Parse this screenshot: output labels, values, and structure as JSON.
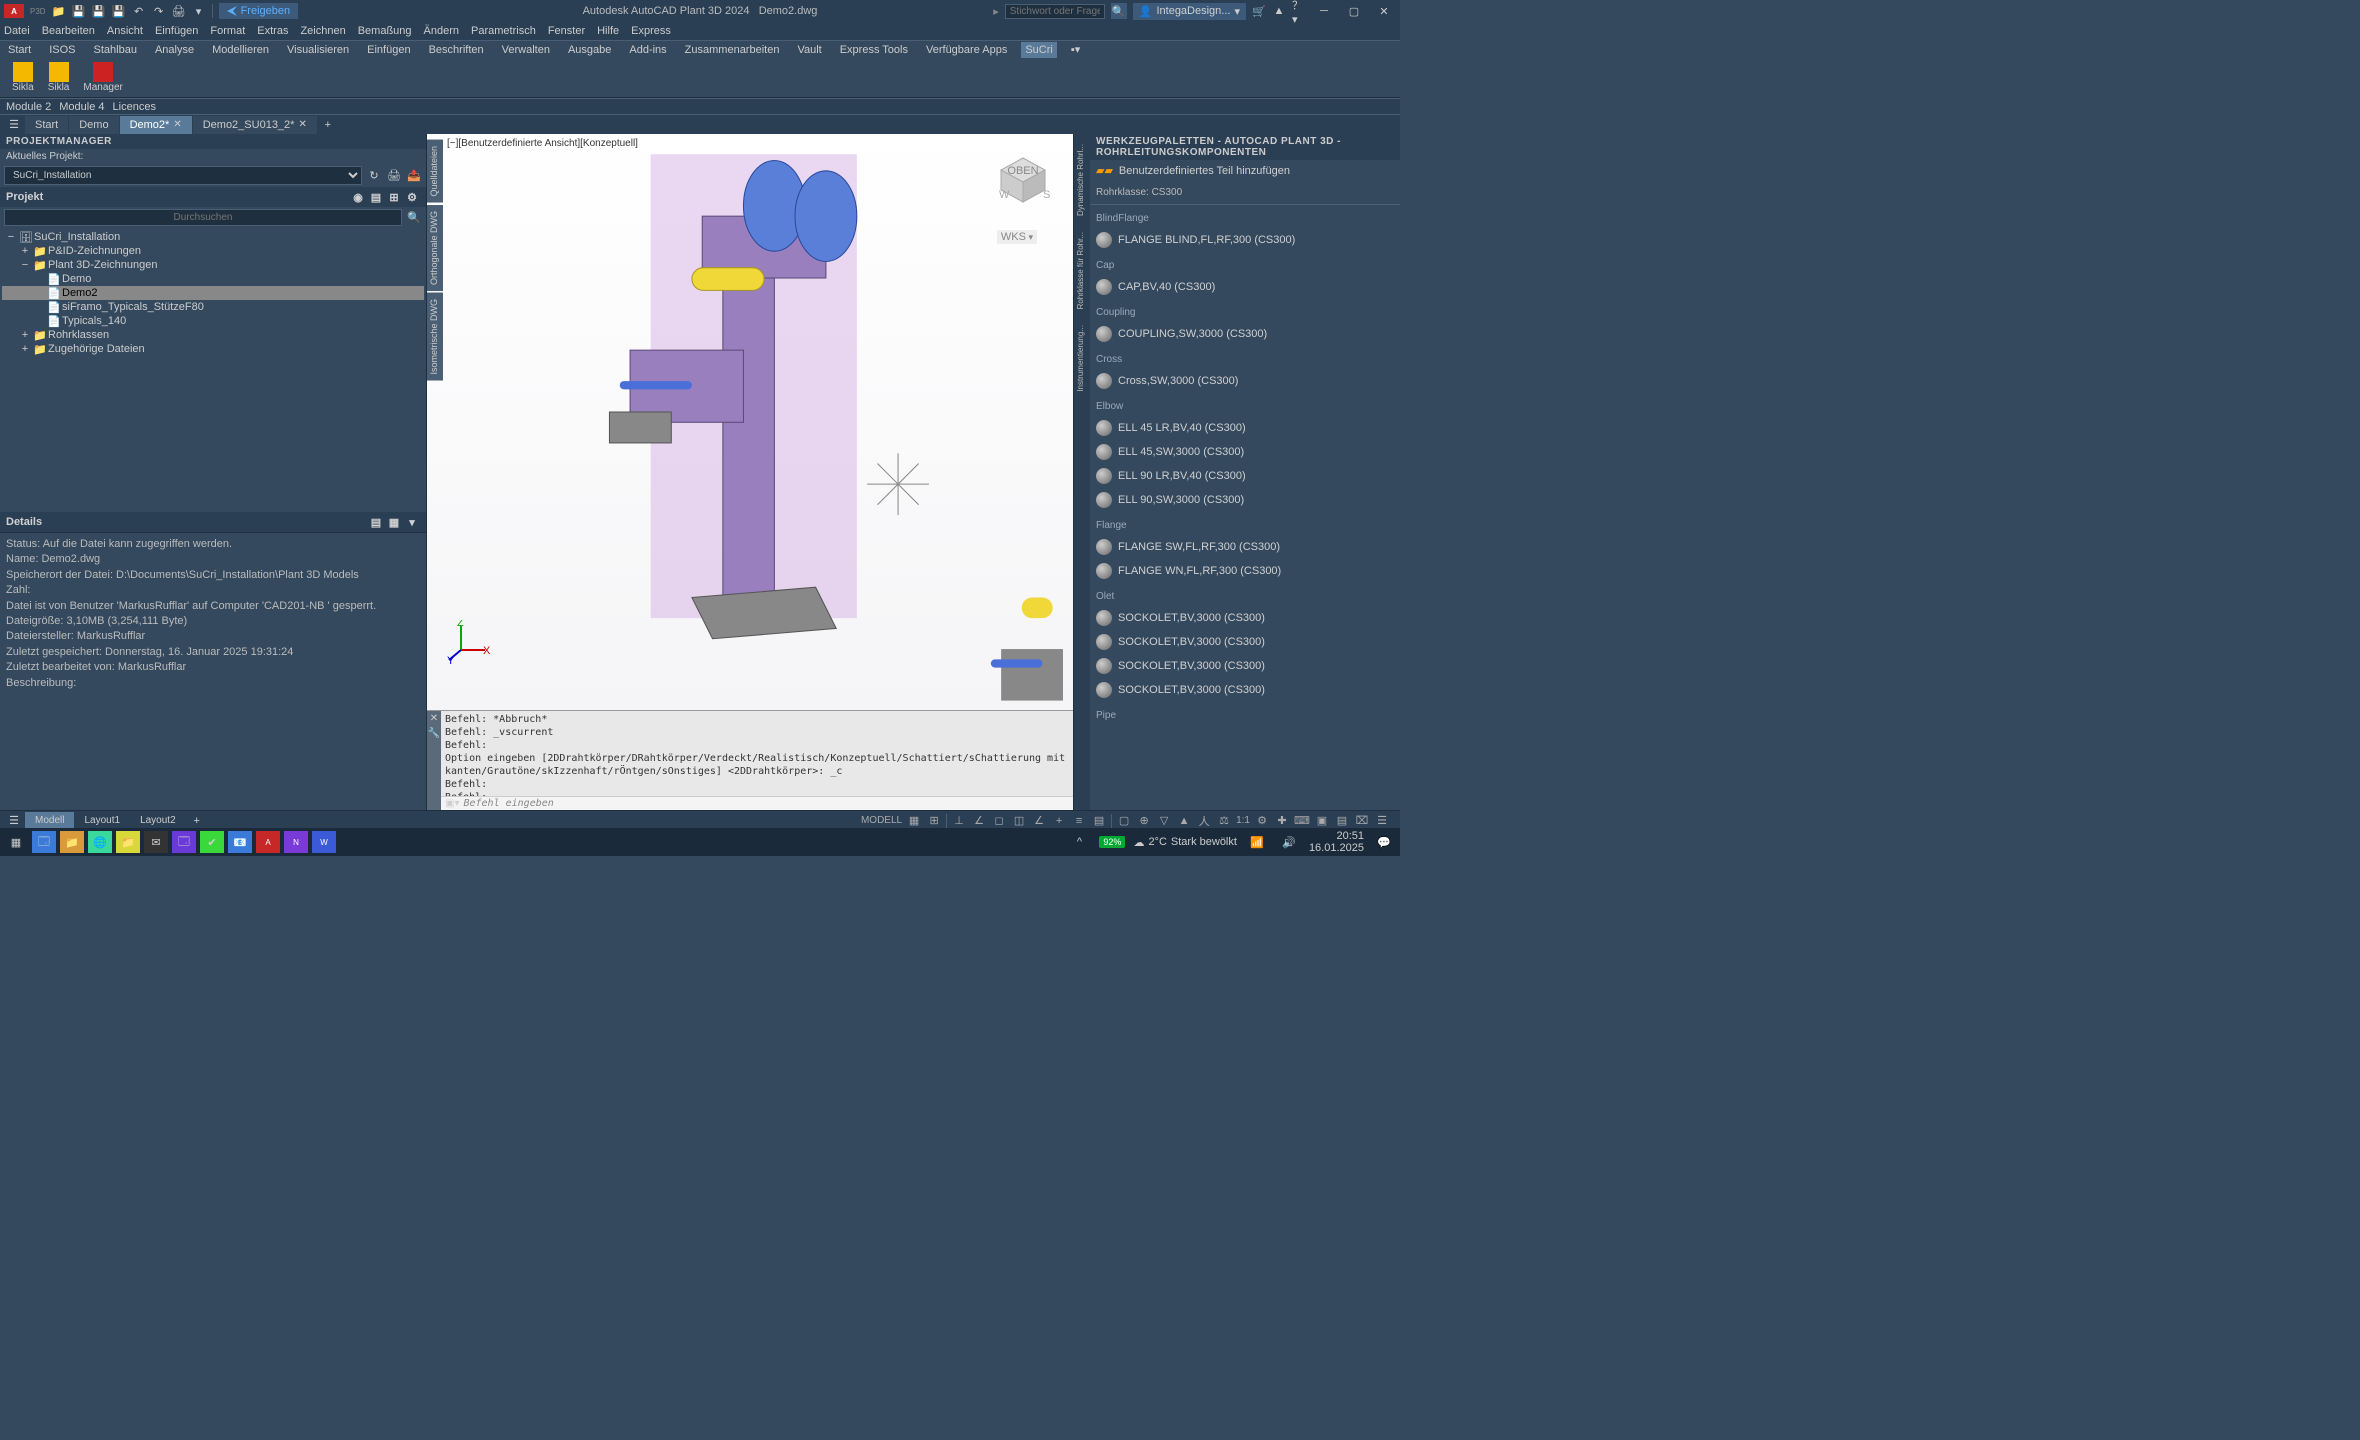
{
  "title": {
    "app": "Autodesk AutoCAD Plant 3D 2024",
    "file": "Demo2.dwg"
  },
  "share_label": "Freigeben",
  "search_placeholder": "Stichwort oder Frage eingeben",
  "user": "IntegaDesign...",
  "menubar": [
    "Datei",
    "Bearbeiten",
    "Ansicht",
    "Einfügen",
    "Format",
    "Extras",
    "Zeichnen",
    "Bemaßung",
    "Ändern",
    "Parametrisch",
    "Fenster",
    "Hilfe",
    "Express"
  ],
  "ribbon_tabs": [
    "Start",
    "ISOS",
    "Stahlbau",
    "Analyse",
    "Modellieren",
    "Visualisieren",
    "Einfügen",
    "Beschriften",
    "Verwalten",
    "Ausgabe",
    "Add-ins",
    "Zusammenarbeiten",
    "Vault",
    "Express Tools",
    "Verfügbare Apps",
    "SuCri"
  ],
  "ribbon_buttons": [
    {
      "label": "Sikla"
    },
    {
      "label": "Sikla"
    },
    {
      "label": "Manager"
    }
  ],
  "panel_labels": [
    "Module 2",
    "Module 4",
    "Licences"
  ],
  "doc_tabs": [
    {
      "label": "Start",
      "closable": false,
      "active": false
    },
    {
      "label": "Demo",
      "closable": false,
      "active": false
    },
    {
      "label": "Demo2*",
      "closable": true,
      "active": true
    },
    {
      "label": "Demo2_SU013_2*",
      "closable": true,
      "active": false
    }
  ],
  "pm": {
    "title": "PROJEKTMANAGER",
    "current_label": "Aktuelles Projekt:",
    "project": "SuCri_Installation",
    "section": "Projekt",
    "search": "Durchsuchen",
    "tree": [
      {
        "indent": 0,
        "toggle": "−",
        "ico": "db",
        "label": "SuCri_Installation"
      },
      {
        "indent": 1,
        "toggle": "+",
        "ico": "fold",
        "label": "P&ID-Zeichnungen"
      },
      {
        "indent": 1,
        "toggle": "−",
        "ico": "fold",
        "label": "Plant 3D-Zeichnungen"
      },
      {
        "indent": 2,
        "toggle": "",
        "ico": "dwg",
        "label": "Demo"
      },
      {
        "indent": 2,
        "toggle": "",
        "ico": "dwg",
        "label": "Demo2",
        "selected": true
      },
      {
        "indent": 2,
        "toggle": "",
        "ico": "dwg",
        "label": "siFramo_Typicals_StützeF80"
      },
      {
        "indent": 2,
        "toggle": "",
        "ico": "dwg",
        "label": "Typicals_140"
      },
      {
        "indent": 1,
        "toggle": "+",
        "ico": "fold",
        "label": "Rohrklassen"
      },
      {
        "indent": 1,
        "toggle": "+",
        "ico": "fold",
        "label": "Zugehörige Dateien"
      }
    ]
  },
  "details": {
    "title": "Details",
    "lines": [
      "Status: Auf die Datei kann zugegriffen werden.",
      "Name: Demo2.dwg",
      "Speicherort der Datei: D:\\Documents\\SuCri_Installation\\Plant 3D Models",
      "Zahl:",
      "Datei ist von Benutzer 'MarkusRufflar' auf Computer 'CAD201-NB ' gesperrt.",
      "Dateigröße: 3,10MB (3,254,111 Byte)",
      "Dateiersteller: MarkusRufflar",
      "Zuletzt gespeichert: Donnerstag, 16. Januar 2025 19:31:24",
      "Zuletzt bearbeitet von: MarkusRufflar",
      "Beschreibung:"
    ]
  },
  "viewport": {
    "label": "[−][Benutzerdefinierte Ansicht][Konzeptuell]",
    "wks": "WKS",
    "side_tabs": [
      "Quelldateien",
      "Orthogonale DWG",
      "Isometrische DWG"
    ]
  },
  "cmd": {
    "lines": [
      "Befehl: *Abbruch*",
      "Befehl: _vscurrent",
      "Befehl:",
      "Option eingeben [2DDrahtkörper/DRahtkörper/Verdeckt/Realistisch/Konzeptuell/Schattiert/sChattierung mit kanten/Grautöne/skIzzenhaft/rÖntgen/sOnstiges] <2DDrahtkörper>: _c",
      "Befehl:",
      "Befehl:",
      "Befehl:",
      "Befehl:"
    ],
    "prompt": "Befehl eingeben"
  },
  "palette": {
    "title": "WERKZEUGPALETTEN - AUTOCAD PLANT 3D - ROHRLEITUNGSKOMPONENTEN",
    "add": "Benutzerdefiniertes Teil hinzufügen",
    "class": "Rohrklasse: CS300",
    "side_tabs": [
      "Dynamische Rohrl...",
      "Rohrklasse für Rohr...",
      "Instrumentierung..."
    ],
    "groups": [
      {
        "name": "BlindFlange",
        "items": [
          "FLANGE BLIND,FL,RF,300 (CS300)"
        ]
      },
      {
        "name": "Cap",
        "items": [
          "CAP,BV,40 (CS300)"
        ]
      },
      {
        "name": "Coupling",
        "items": [
          "COUPLING,SW,3000 (CS300)"
        ]
      },
      {
        "name": "Cross",
        "items": [
          "Cross,SW,3000 (CS300)"
        ]
      },
      {
        "name": "Elbow",
        "items": [
          "ELL 45 LR,BV,40 (CS300)",
          "ELL 45,SW,3000 (CS300)",
          "ELL 90 LR,BV,40 (CS300)",
          "ELL 90,SW,3000 (CS300)"
        ]
      },
      {
        "name": "Flange",
        "items": [
          "FLANGE SW,FL,RF,300 (CS300)",
          "FLANGE WN,FL,RF,300 (CS300)"
        ]
      },
      {
        "name": "Olet",
        "items": [
          "SOCKOLET,BV,3000 (CS300)",
          "SOCKOLET,BV,3000 (CS300)",
          "SOCKOLET,BV,3000 (CS300)",
          "SOCKOLET,BV,3000 (CS300)"
        ]
      },
      {
        "name": "Pipe",
        "items": []
      }
    ]
  },
  "bottom": {
    "tabs": [
      "Modell",
      "Layout1",
      "Layout2"
    ],
    "model": "MODELL",
    "scale": "1:1"
  },
  "taskbar": {
    "weather_temp": "2°C",
    "weather_text": "Stark bewölkt",
    "battery": "92%",
    "time": "20:51",
    "date": "16.01.2025"
  }
}
